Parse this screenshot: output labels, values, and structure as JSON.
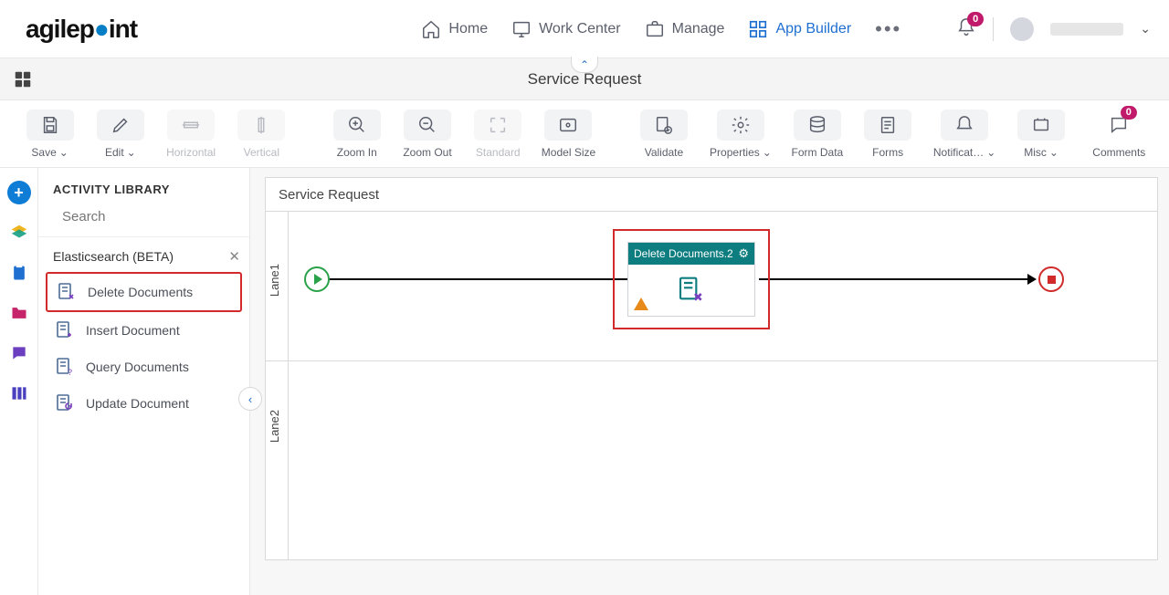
{
  "brand": {
    "name": "agilepoint"
  },
  "nav": {
    "home": "Home",
    "workcenter": "Work Center",
    "manage": "Manage",
    "appbuilder": "App Builder",
    "bell_count": "0"
  },
  "header": {
    "title": "Service Request"
  },
  "toolbar": {
    "save": "Save",
    "edit": "Edit",
    "horizontal": "Horizontal",
    "vertical": "Vertical",
    "zoom_in": "Zoom In",
    "zoom_out": "Zoom Out",
    "standard": "Standard",
    "model_size": "Model Size",
    "validate": "Validate",
    "properties": "Properties",
    "form_data": "Form Data",
    "forms": "Forms",
    "notifications": "Notificat…",
    "misc": "Misc",
    "comments": "Comments",
    "comments_count": "0"
  },
  "library": {
    "heading": "ACTIVITY LIBRARY",
    "search_placeholder": "Search",
    "section": "Elasticsearch (BETA)",
    "items": [
      {
        "label": "Delete Documents"
      },
      {
        "label": "Insert Document"
      },
      {
        "label": "Query Documents"
      },
      {
        "label": "Update Document"
      }
    ]
  },
  "canvas": {
    "title": "Service Request",
    "lane1": "Lane1",
    "lane2": "Lane2",
    "activity_title": "Delete Documents.2"
  }
}
